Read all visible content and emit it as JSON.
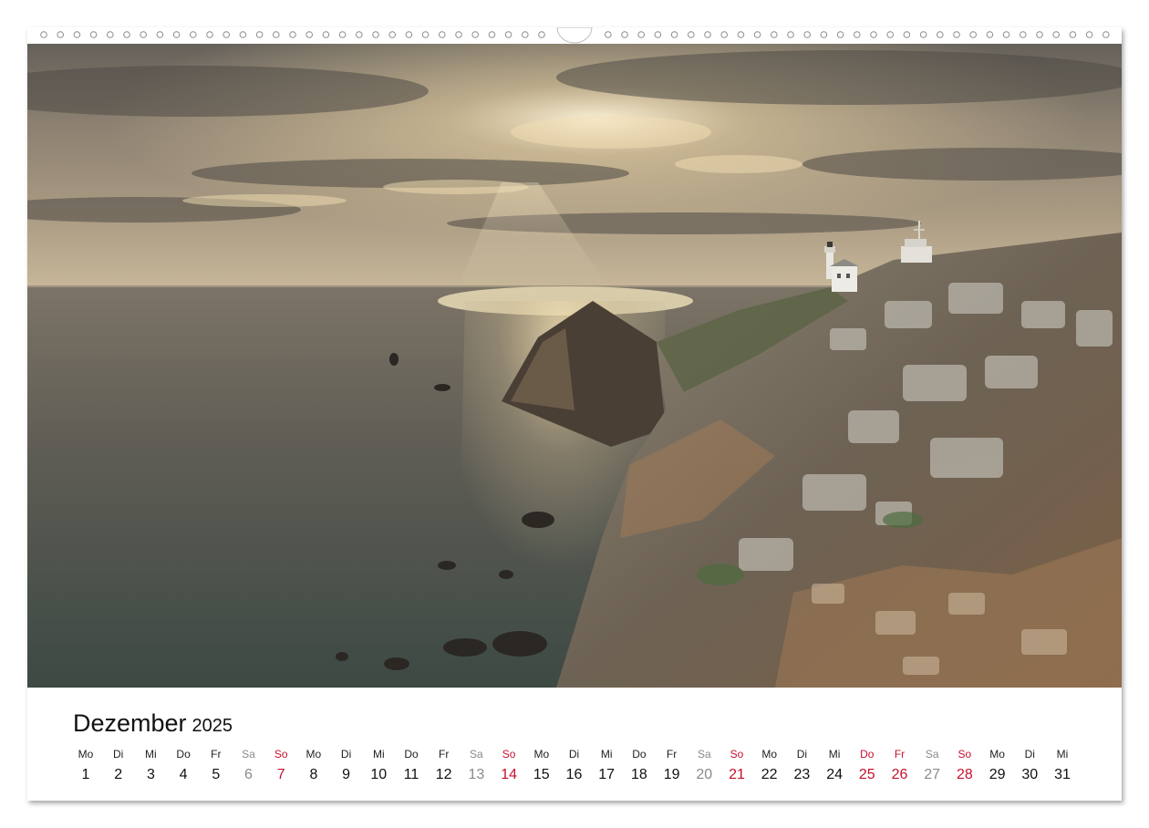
{
  "calendar": {
    "month": "Dezember",
    "year": "2025",
    "days": [
      {
        "wd": "Mo",
        "d": "1",
        "type": "weekday"
      },
      {
        "wd": "Di",
        "d": "2",
        "type": "weekday"
      },
      {
        "wd": "Mi",
        "d": "3",
        "type": "weekday"
      },
      {
        "wd": "Do",
        "d": "4",
        "type": "weekday"
      },
      {
        "wd": "Fr",
        "d": "5",
        "type": "weekday"
      },
      {
        "wd": "Sa",
        "d": "6",
        "type": "sat"
      },
      {
        "wd": "So",
        "d": "7",
        "type": "sun"
      },
      {
        "wd": "Mo",
        "d": "8",
        "type": "weekday"
      },
      {
        "wd": "Di",
        "d": "9",
        "type": "weekday"
      },
      {
        "wd": "Mi",
        "d": "10",
        "type": "weekday"
      },
      {
        "wd": "Do",
        "d": "11",
        "type": "weekday"
      },
      {
        "wd": "Fr",
        "d": "12",
        "type": "weekday"
      },
      {
        "wd": "Sa",
        "d": "13",
        "type": "sat"
      },
      {
        "wd": "So",
        "d": "14",
        "type": "sun"
      },
      {
        "wd": "Mo",
        "d": "15",
        "type": "weekday"
      },
      {
        "wd": "Di",
        "d": "16",
        "type": "weekday"
      },
      {
        "wd": "Mi",
        "d": "17",
        "type": "weekday"
      },
      {
        "wd": "Do",
        "d": "18",
        "type": "weekday"
      },
      {
        "wd": "Fr",
        "d": "19",
        "type": "weekday"
      },
      {
        "wd": "Sa",
        "d": "20",
        "type": "sat"
      },
      {
        "wd": "So",
        "d": "21",
        "type": "sun"
      },
      {
        "wd": "Mo",
        "d": "22",
        "type": "weekday"
      },
      {
        "wd": "Di",
        "d": "23",
        "type": "weekday"
      },
      {
        "wd": "Mi",
        "d": "24",
        "type": "weekday"
      },
      {
        "wd": "Do",
        "d": "25",
        "type": "holiday"
      },
      {
        "wd": "Fr",
        "d": "26",
        "type": "holiday"
      },
      {
        "wd": "Sa",
        "d": "27",
        "type": "sat"
      },
      {
        "wd": "So",
        "d": "28",
        "type": "sun"
      },
      {
        "wd": "Mo",
        "d": "29",
        "type": "weekday"
      },
      {
        "wd": "Di",
        "d": "30",
        "type": "weekday"
      },
      {
        "wd": "Mi",
        "d": "31",
        "type": "weekday"
      }
    ]
  },
  "colors": {
    "sunday_holiday": "#c8102e",
    "saturday": "#8a8a8a",
    "text": "#111111"
  },
  "photo": {
    "icons": [
      "lighthouse-icon",
      "signal-tower-icon"
    ]
  }
}
